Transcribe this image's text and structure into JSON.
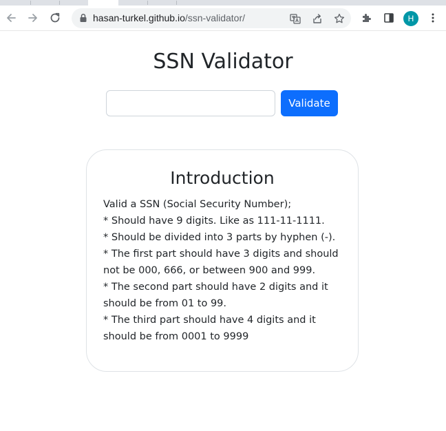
{
  "browser": {
    "url_host": "hasan-turkel.github.io",
    "url_path": "/ssn-validator/",
    "profile_initial": "H",
    "accent_color": "#0097a7"
  },
  "page": {
    "title": "SSN Validator",
    "input": {
      "value": "",
      "placeholder": ""
    },
    "validate_button": {
      "label": "Validate",
      "color": "#0d6efd"
    },
    "intro": {
      "heading": "Introduction",
      "lines": [
        "Valid a SSN (Social Security Number);",
        "* Should have 9 digits. Like as 111-11-1111.",
        "* Should be divided into 3 parts by hyphen (-).",
        "* The first part should have 3 digits and should not be 000, 666, or between 900 and 999.",
        "* The second part should have 2 digits and it should be from 01 to 99.",
        "* The third part should have 4 digits and it should be from 0001 to 9999"
      ]
    }
  }
}
